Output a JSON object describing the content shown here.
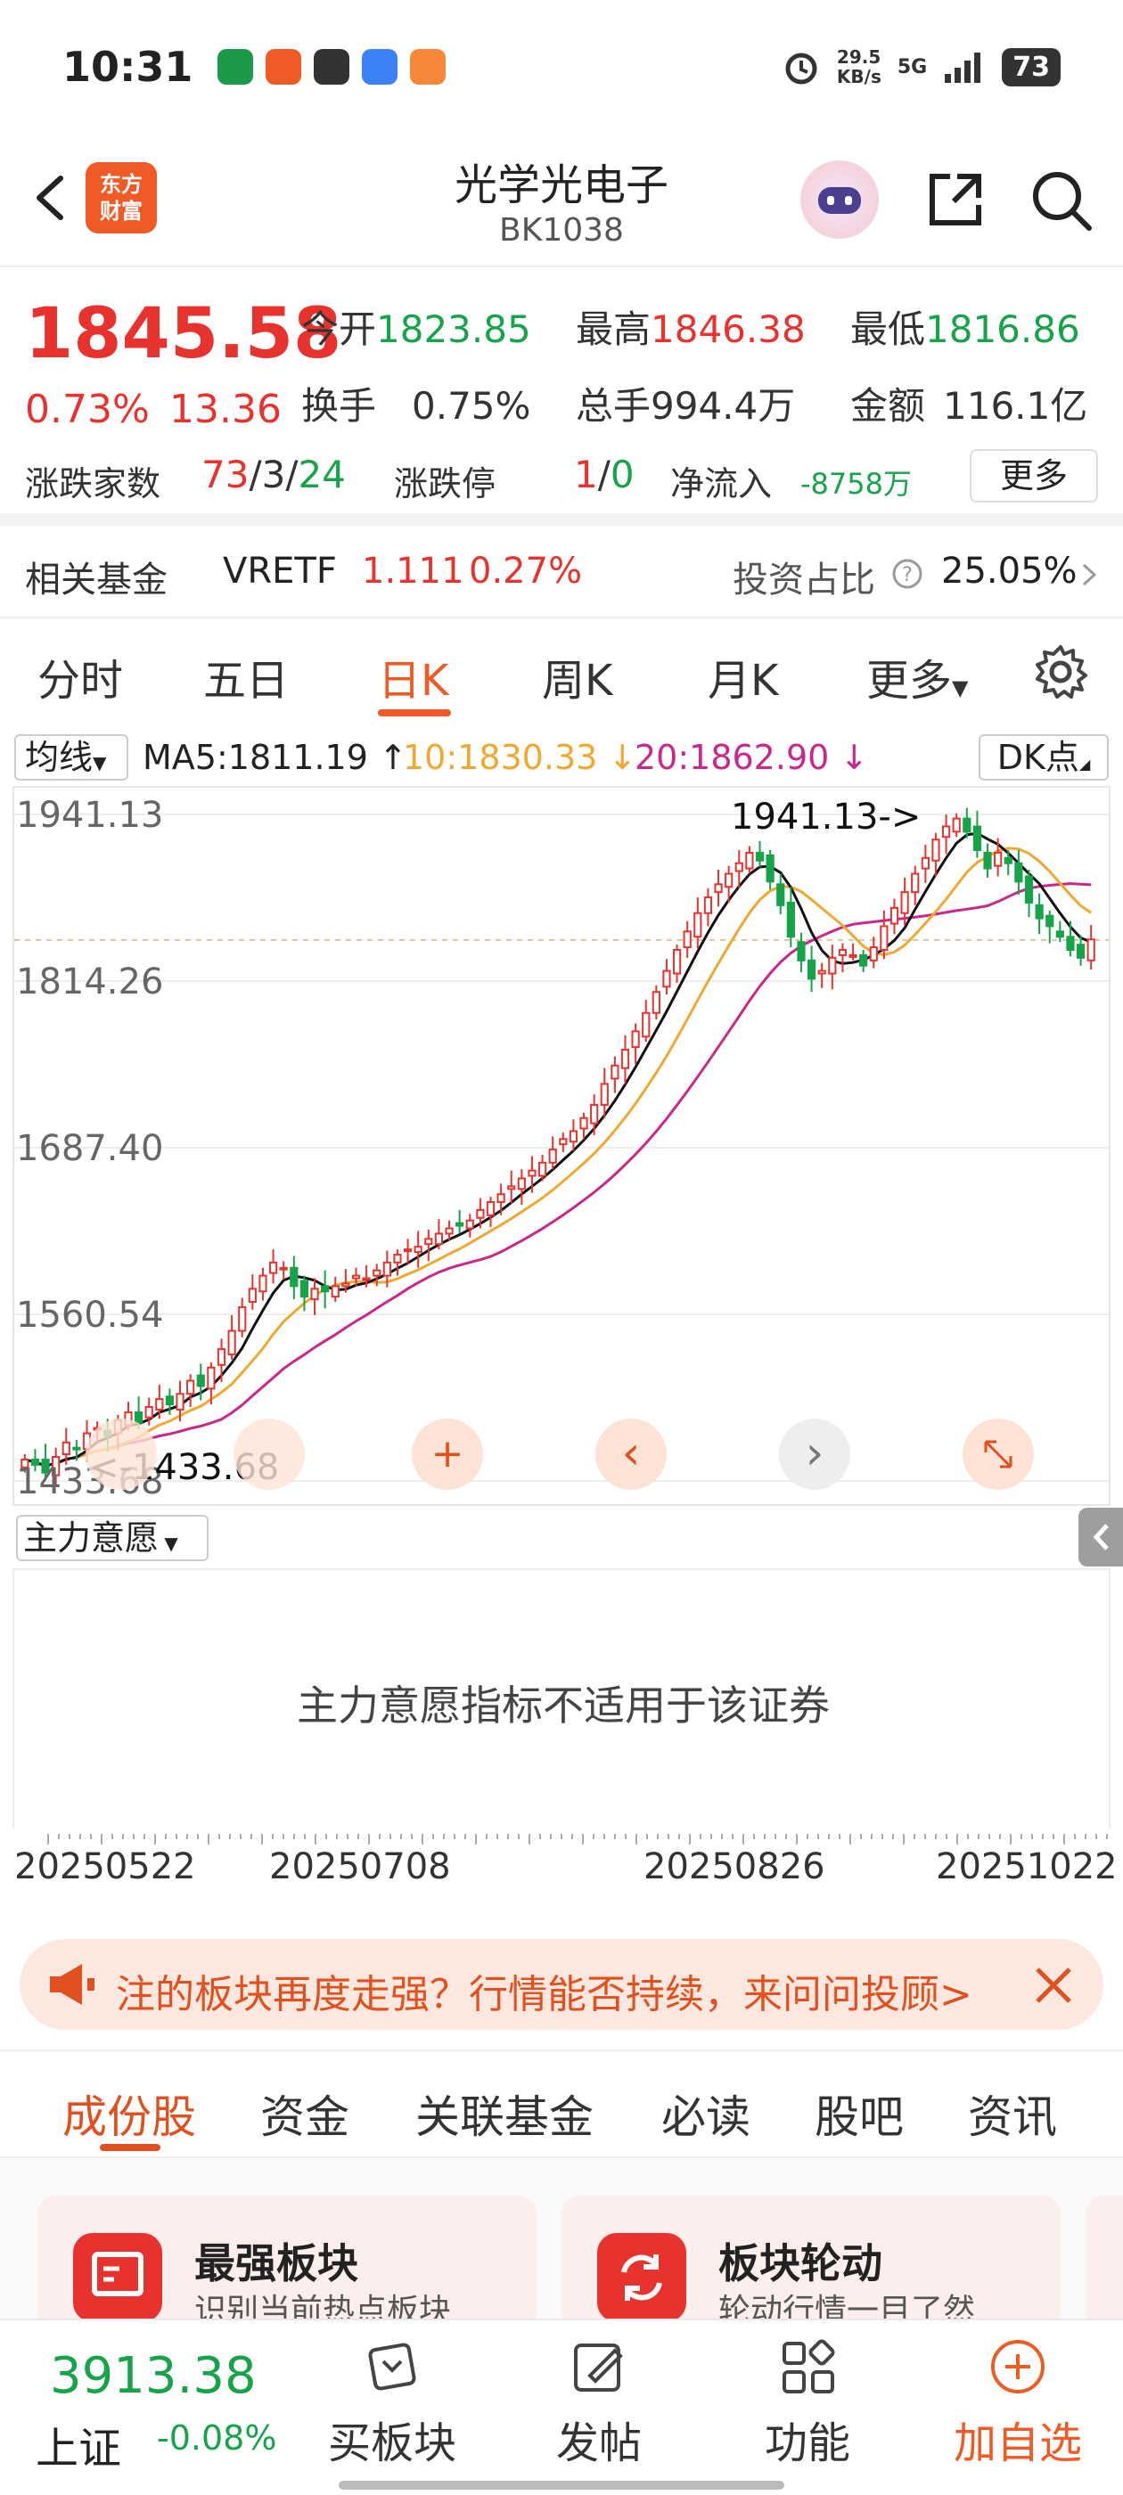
{
  "status_bar": {
    "time": "10:31",
    "net_speed": "29.5\nKB/s",
    "network": "5G",
    "battery": "73"
  },
  "header": {
    "title": "光学光电子",
    "code": "BK1038",
    "logo_text": "东方\n财富"
  },
  "quote": {
    "price": "1845.58",
    "change_pct": "0.73%",
    "change": "13.36",
    "open_label": "今开",
    "open": "1823.85",
    "high_label": "最高",
    "high": "1846.38",
    "low_label": "最低",
    "low": "1816.86",
    "turnover_label": "换手",
    "turnover": "0.75%",
    "volume_label": "总手",
    "volume": "994.4万",
    "amount_label": "金额",
    "amount": "116.1亿",
    "adv_dec_label": "涨跌家数",
    "adv": "73",
    "flat": "3",
    "dec": "24",
    "limit_label": "涨跌停",
    "limit_up": "1",
    "limit_down": "0",
    "netflow_label": "净流入",
    "netflow": "-8758万",
    "more_label": "更多"
  },
  "fund": {
    "label": "相关基金",
    "name": "VRETF",
    "price": "1.111",
    "change": "0.27%",
    "ratio_label": "投资占比",
    "ratio": "25.05%"
  },
  "kline_tabs": [
    "分时",
    "五日",
    "日K",
    "周K",
    "月K",
    "更多"
  ],
  "kline_active": "日K",
  "ma": {
    "button": "均线",
    "ma5": "MA5:1811.19 ↑",
    "ma10": "10:1830.33 ↓",
    "ma20": "20:1862.90 ↓",
    "dk_button": "DK点"
  },
  "colors": {
    "up": "#e8322e",
    "down": "#16a34a",
    "ma5": "#111111",
    "ma10": "#f0a830",
    "ma20": "#c8288c",
    "accent": "#f05a24"
  },
  "chart_data": {
    "type": "candlestick",
    "y_ticks": [
      "1941.13",
      "1814.26",
      "1687.40",
      "1560.54",
      "1433.68"
    ],
    "ylim": [
      1433.68,
      1941.13
    ],
    "x_ticks": [
      "20250522",
      "20250708",
      "20250826",
      "20251022"
    ],
    "annotations": {
      "high_marker": "1941.13->",
      "low_marker": "<-1433.68"
    },
    "series_close": [
      1450,
      1446,
      1440,
      1452,
      1463,
      1458,
      1470,
      1474,
      1468,
      1480,
      1486,
      1478,
      1490,
      1496,
      1492,
      1500,
      1510,
      1506,
      1520,
      1534,
      1548,
      1566,
      1580,
      1590,
      1600,
      1596,
      1582,
      1574,
      1580,
      1578,
      1582,
      1584,
      1590,
      1588,
      1594,
      1600,
      1606,
      1610,
      1612,
      1618,
      1622,
      1626,
      1628,
      1632,
      1640,
      1646,
      1652,
      1658,
      1664,
      1670,
      1676,
      1686,
      1694,
      1700,
      1710,
      1720,
      1736,
      1750,
      1762,
      1776,
      1790,
      1806,
      1822,
      1838,
      1852,
      1866,
      1878,
      1888,
      1896,
      1904,
      1912,
      1906,
      1890,
      1872,
      1848,
      1830,
      1816,
      1822,
      1832,
      1838,
      1834,
      1826,
      1840,
      1856,
      1870,
      1882,
      1896,
      1908,
      1922,
      1932,
      1938,
      1928,
      1914,
      1900,
      1912,
      1904,
      1890,
      1874,
      1862,
      1856,
      1848,
      1838,
      1832,
      1846
    ],
    "ma5_label": "MA5",
    "ma10_label": "MA10",
    "ma20_label": "MA20"
  },
  "chart_controls": {
    "plus": "+",
    "prev": "‹",
    "next": "›"
  },
  "indicator": {
    "button": "主力意愿",
    "message": "主力意愿指标不适用于该证券"
  },
  "banner": {
    "text": "注的板块再度走强？行情能否持续，来问问投顾>"
  },
  "section_tabs": [
    "成份股",
    "资金",
    "关联基金",
    "必读",
    "股吧",
    "资讯"
  ],
  "section_active": "成份股",
  "cards": [
    {
      "title": "最强板块",
      "sub": "识别当前热点板块"
    },
    {
      "title": "板块轮动",
      "sub": "轮动行情一目了然"
    }
  ],
  "bottom_nav": {
    "index_value": "3913.38",
    "index_name": "上证",
    "index_change": "-0.08%",
    "items": [
      {
        "label": "买板块",
        "icon": "cart-icon"
      },
      {
        "label": "发帖",
        "icon": "edit-icon"
      },
      {
        "label": "功能",
        "icon": "grid-icon"
      },
      {
        "label": "加自选",
        "icon": "plus-circle-icon"
      }
    ]
  }
}
